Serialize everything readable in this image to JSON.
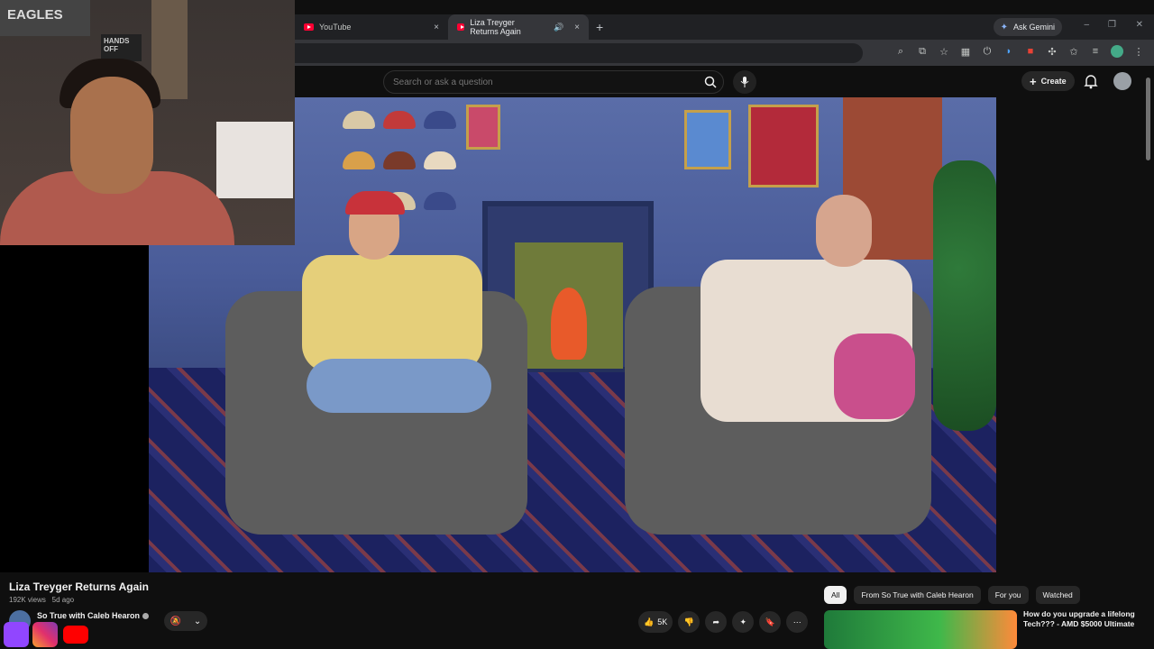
{
  "browser": {
    "tabs": [
      {
        "title": "YouTube",
        "active": false
      },
      {
        "title": "Liza Treyger Returns Again",
        "active": true
      }
    ],
    "new_tab": "+",
    "close_glyph": "×",
    "gemini_label": "Ask Gemini",
    "window_controls": [
      "–",
      "❐",
      "✕"
    ]
  },
  "youtube": {
    "search_placeholder": "Search or ask a question",
    "create_label": "Create"
  },
  "video": {
    "title": "Liza Treyger Returns Again",
    "views": "192K views",
    "age": "5d ago",
    "channel": "So True with Caleb Hearon",
    "likes": "5K"
  },
  "webcam": {
    "sign_top": "EAGLES",
    "sign_hands": "HANDS OFF"
  },
  "filters": [
    "All",
    "From So True with Caleb Hearon",
    "For you",
    "Watched"
  ],
  "recommendation": {
    "title": "How do you upgrade a lifelong Tech??? - AMD $5000 Ultimate"
  },
  "colors": {
    "background": "#0f0f0f",
    "youtube_red": "#ff0033",
    "chip_bg": "#272727"
  }
}
